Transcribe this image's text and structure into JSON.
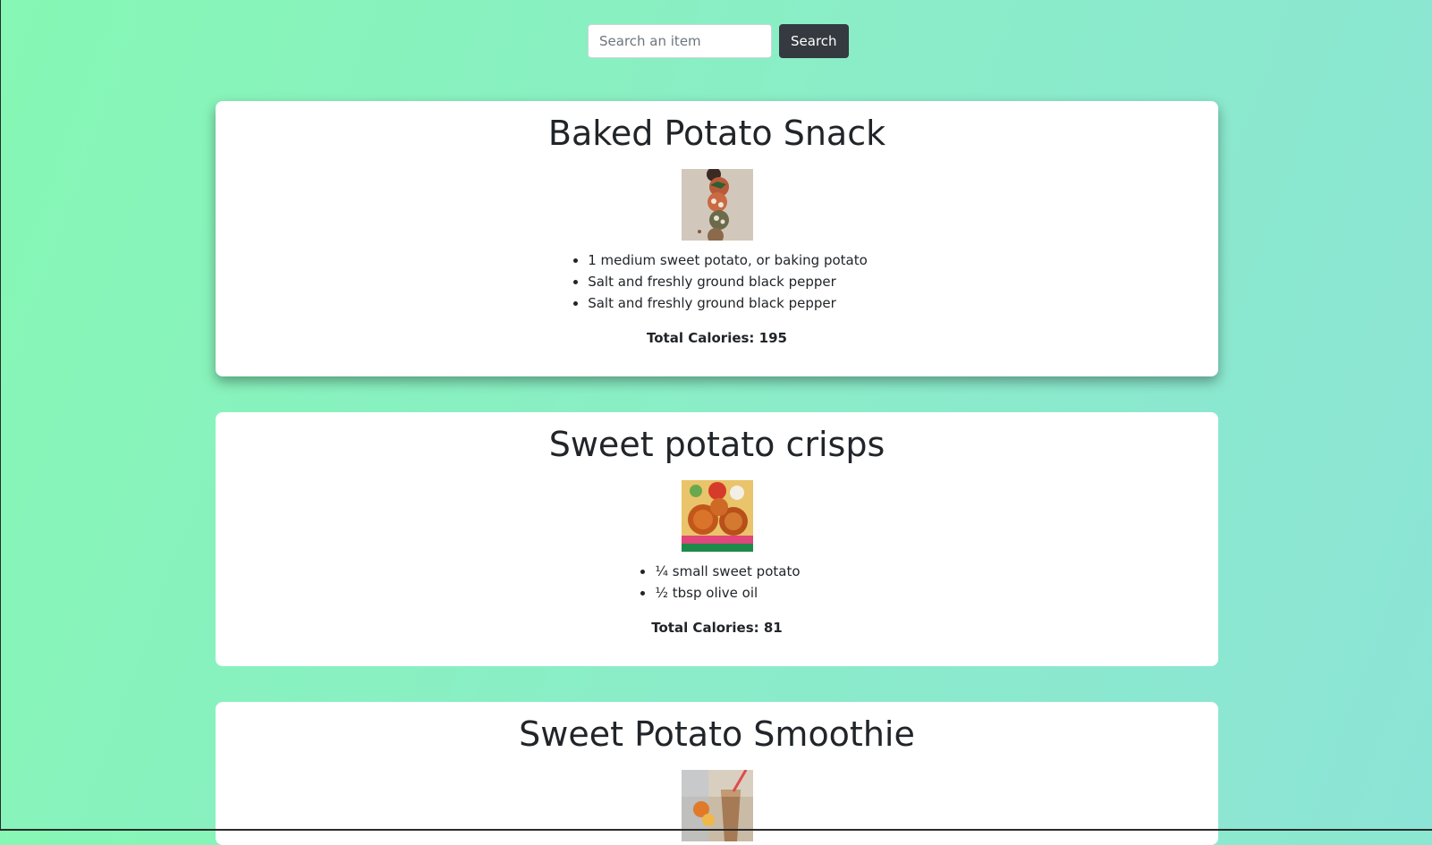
{
  "search": {
    "placeholder": "Search an item",
    "button_label": "Search"
  },
  "recipes": [
    {
      "title": "Baked Potato Snack",
      "image": "baked-potato-snack-photo",
      "ingredients": [
        "1 medium sweet potato, or baking potato",
        "Salt and freshly ground black pepper",
        "Salt and freshly ground black pepper"
      ],
      "calories": "Total Calories: 195"
    },
    {
      "title": "Sweet potato crisps",
      "image": "sweet-potato-crisps-photo",
      "ingredients": [
        "¼ small sweet potato",
        "½ tbsp olive oil"
      ],
      "calories": "Total Calories: 81"
    },
    {
      "title": "Sweet Potato Smoothie",
      "image": "sweet-potato-smoothie-photo"
    }
  ],
  "colors": {
    "background_start": "#86f7b4",
    "background_end": "#8ce4d6",
    "button": "#343a40",
    "text": "#212529"
  }
}
